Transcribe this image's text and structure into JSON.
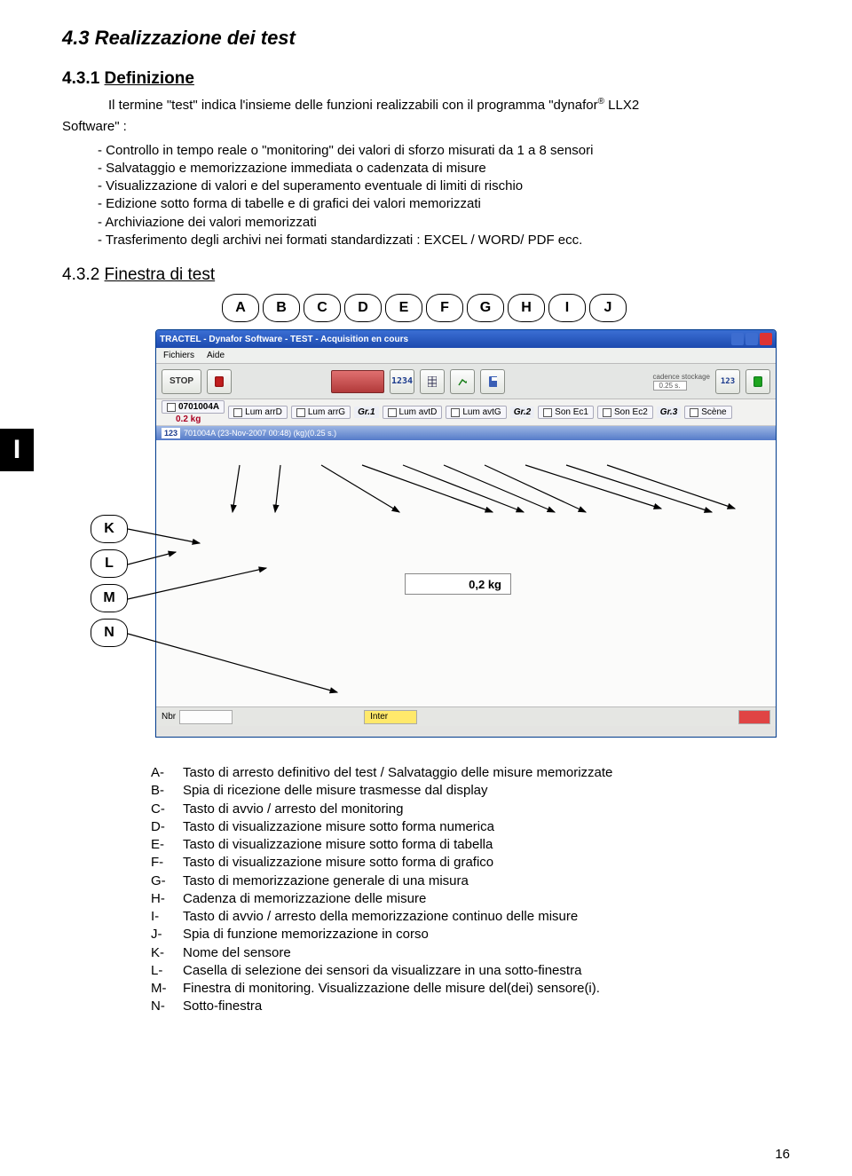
{
  "headings": {
    "h1": "4.3  Realizzazione dei test",
    "h2_num": "4.3.1 ",
    "h2_txt": "Definizione",
    "h2b_num": "4.3.2 ",
    "h2b_txt": "Finestra di test"
  },
  "intro_line1": "Il termine \"test\" indica l'insieme delle funzioni realizzabili con il programma \"dynafor",
  "intro_sup": "®",
  "intro_line1b": " LLX2",
  "intro_line2": "Software\" :",
  "bullets": [
    "Controllo in tempo reale o \"monitoring\" dei valori di sforzo misurati da  1 a 8 sensori",
    "Salvataggio e memorizzazione immediata o cadenzata di misure",
    "Visualizzazione di valori e del superamento eventuale di limiti di rischio",
    "Edizione sotto forma di tabelle e di grafici dei valori memorizzati",
    "Archiviazione dei valori memorizzati",
    "Trasferimento degli archivi nei formati standardizzati : EXCEL / WORD/ PDF ecc."
  ],
  "lang_tab": "I",
  "callouts_row": [
    "A",
    "B",
    "C",
    "D",
    "E",
    "F",
    "G",
    "H",
    "I",
    "J"
  ],
  "callouts_col": [
    "K",
    "L",
    "M",
    "N"
  ],
  "app": {
    "title": "TRACTEL - Dynafor Software - TEST - Acquisition en cours",
    "menu": [
      "Fichiers",
      "Aide"
    ],
    "toolbar": {
      "stop": "STOP",
      "digits": "1234",
      "cadence_label": "cadence stockage",
      "cadence_val": "0.25 s.",
      "num": "123"
    },
    "sensor_row": {
      "sensor_id": "0701004A",
      "sensor_val": "0.2 kg",
      "groups": [
        "Gr.1",
        "Gr.2",
        "Gr.3"
      ],
      "cols": [
        "Lum arrD",
        "Lum arrG",
        "Lum avtD",
        "Lum avtG",
        "Son Ec1",
        "Son Ec2",
        "Scène"
      ]
    },
    "monitor_bar": "701004A (23-Nov-2007 00:48) (kg)(0.25 s.)",
    "monitor_num": "123",
    "reading": "0,2 kg",
    "status": {
      "nbr": "Nbr",
      "inter": "Inter"
    }
  },
  "legend": [
    {
      "k": "A-",
      "t": "Tasto di arresto definitivo del test / Salvataggio delle misure memorizzate"
    },
    {
      "k": "B-",
      "t": "Spia di ricezione delle misure trasmesse dal display"
    },
    {
      "k": "C-",
      "t": "Tasto di avvio / arresto del monitoring"
    },
    {
      "k": "D-",
      "t": "Tasto di visualizzazione misure sotto forma numerica"
    },
    {
      "k": "E-",
      "t": "Tasto di visualizzazione misure sotto forma di tabella"
    },
    {
      "k": "F-",
      "t": "Tasto di visualizzazione misure sotto forma di grafico"
    },
    {
      "k": "G-",
      "t": "Tasto di memorizzazione generale di una misura"
    },
    {
      "k": "H-",
      "t": "Cadenza di memorizzazione delle misure"
    },
    {
      "k": "I-",
      "t": "Tasto di avvio / arresto della memorizzazione continuo delle misure"
    },
    {
      "k": "J-",
      "t": "Spia di funzione memorizzazione in corso"
    },
    {
      "k": "K-",
      "t": "Nome del sensore"
    },
    {
      "k": "L-",
      "t": "Casella di selezione dei sensori da visualizzare in una sotto-finestra"
    },
    {
      "k": "M-",
      "t": "Finestra di monitoring. Visualizzazione delle misure del(dei) sensore(i)."
    },
    {
      "k": "N-",
      "t": "Sotto-finestra"
    }
  ],
  "page_num": "16"
}
